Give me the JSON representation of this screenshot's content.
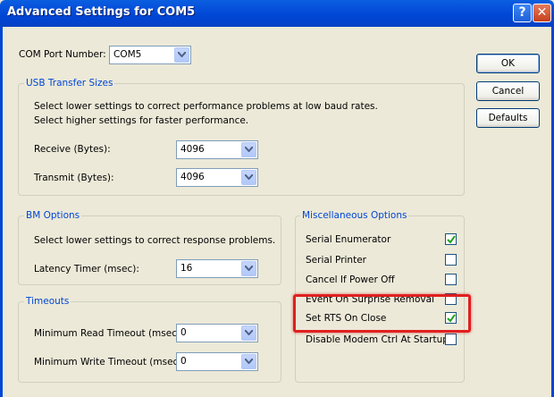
{
  "window": {
    "title": "Advanced Settings for COM5",
    "help_glyph": "?",
    "close_glyph": "✕"
  },
  "com_port": {
    "label": "COM Port Number:",
    "value": "COM5"
  },
  "buttons": {
    "ok": "OK",
    "cancel": "Cancel",
    "defaults": "Defaults"
  },
  "usb": {
    "title": "USB Transfer Sizes",
    "line1": "Select lower settings to correct performance problems at low baud rates.",
    "line2": "Select higher settings for faster performance.",
    "receive_label": "Receive (Bytes):",
    "receive_value": "4096",
    "transmit_label": "Transmit (Bytes):",
    "transmit_value": "4096"
  },
  "bm": {
    "title": "BM Options",
    "desc": "Select lower settings to correct response problems.",
    "latency_label": "Latency Timer (msec):",
    "latency_value": "16"
  },
  "timeouts": {
    "title": "Timeouts",
    "read_label": "Minimum Read Timeout (msec):",
    "read_value": "0",
    "write_label": "Minimum Write Timeout (msec):",
    "write_value": "0"
  },
  "misc": {
    "title": "Miscellaneous Options",
    "items": [
      {
        "label": "Serial Enumerator",
        "checked": true
      },
      {
        "label": "Serial Printer",
        "checked": false
      },
      {
        "label": "Cancel If Power Off",
        "checked": false
      },
      {
        "label": "Event On Surprise Removal",
        "checked": false
      },
      {
        "label": "Set RTS On Close",
        "checked": true
      },
      {
        "label": "Disable Modem Ctrl At Startup",
        "checked": false
      }
    ]
  },
  "colors": {
    "accent": "#0046d5",
    "highlight": "#e02020",
    "check": "#21a121"
  }
}
